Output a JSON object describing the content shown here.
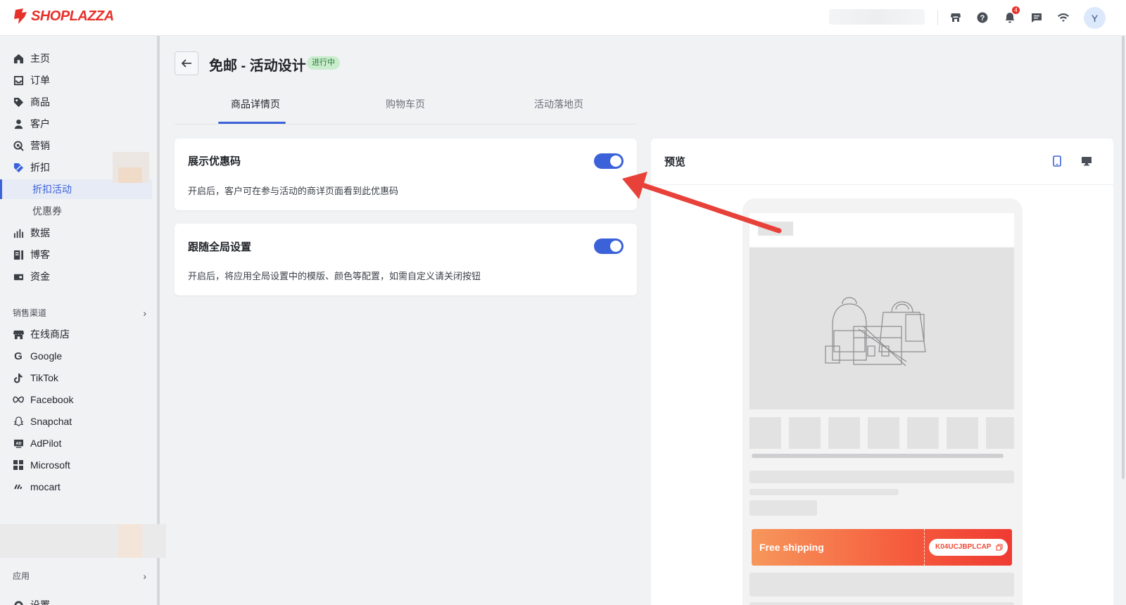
{
  "header": {
    "logo_text": "SHOPLAZZA",
    "notification_count": "4",
    "avatar_initial": "Y",
    "icons": [
      "store-icon",
      "help-icon",
      "bell-icon",
      "chat-icon",
      "wifi-icon"
    ]
  },
  "sidebar": {
    "items": [
      {
        "label": "主页",
        "icon": "home-icon"
      },
      {
        "label": "订单",
        "icon": "order-icon"
      },
      {
        "label": "商品",
        "icon": "tag-icon"
      },
      {
        "label": "客户",
        "icon": "user-icon"
      },
      {
        "label": "营销",
        "icon": "marketing-icon"
      },
      {
        "label": "折扣",
        "icon": "discount-icon"
      },
      {
        "label": "折扣活动",
        "icon": ""
      },
      {
        "label": "优惠券",
        "icon": ""
      },
      {
        "label": "数据",
        "icon": "chart-icon"
      },
      {
        "label": "博客",
        "icon": "blog-icon"
      },
      {
        "label": "资金",
        "icon": "wallet-icon"
      }
    ],
    "sales_channels_label": "销售渠道",
    "channels": [
      {
        "label": "在线商店",
        "icon": "store-icon"
      },
      {
        "label": "Google",
        "icon": "google-icon"
      },
      {
        "label": "TikTok",
        "icon": "tiktok-icon"
      },
      {
        "label": "Facebook",
        "icon": "meta-icon"
      },
      {
        "label": "Snapchat",
        "icon": "snapchat-icon"
      },
      {
        "label": "AdPilot",
        "icon": "adpilot-icon"
      },
      {
        "label": "Microsoft",
        "icon": "microsoft-icon"
      },
      {
        "label": "mocart",
        "icon": "mocart-icon"
      }
    ],
    "apps_label": "应用",
    "settings_label": "设置"
  },
  "page": {
    "title": "免邮 - 活动设计",
    "status": "进行中",
    "tabs": [
      {
        "label": "商品详情页"
      },
      {
        "label": "购物车页"
      },
      {
        "label": "活动落地页"
      }
    ]
  },
  "cards": [
    {
      "title": "展示优惠码",
      "desc": "开启后，客户可在参与活动的商详页面看到此优惠码",
      "enabled": true
    },
    {
      "title": "跟随全局设置",
      "desc": "开启后，将应用全局设置中的模版、颜色等配置，如需自定义请关闭按钮",
      "enabled": true
    }
  ],
  "preview": {
    "title": "预览",
    "coupon_label": "Free shipping",
    "coupon_code": "K04UCJBPLCAP"
  },
  "colors": {
    "accent": "#3b62d8",
    "brand": "#e8302a",
    "badge_bg": "#c9eccd",
    "coupon_start": "#f7975c",
    "coupon_end": "#ef3b33",
    "arrow": "#e8413a"
  }
}
